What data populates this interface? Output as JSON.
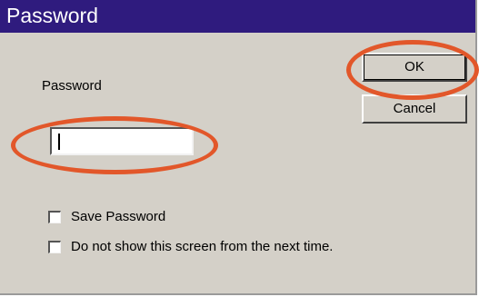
{
  "window": {
    "title": "Password"
  },
  "form": {
    "password_label": "Password",
    "password_value": "",
    "ok_label": "OK",
    "cancel_label": "Cancel"
  },
  "options": [
    {
      "label": "Save Password",
      "checked": false
    },
    {
      "label": "Do not show this screen from the next time.",
      "checked": false
    }
  ],
  "annotations": {
    "highlight_color": "#e2572a"
  },
  "colors": {
    "titlebar": "#2f1b7e",
    "dialog_bg": "#d4d0c8"
  }
}
